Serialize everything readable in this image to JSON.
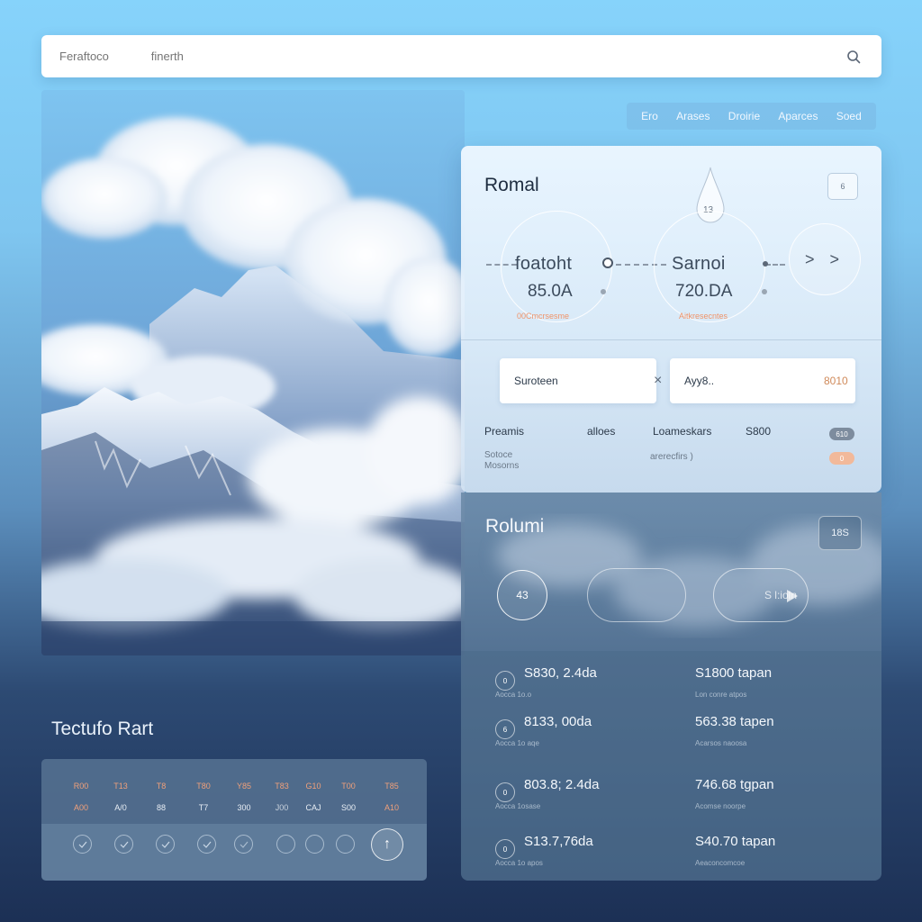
{
  "search": {
    "placeholder": "Feraftoco   finerth"
  },
  "top_nav": {
    "items": [
      "Ero",
      "Arases",
      "Droirie",
      "Aparces",
      "Soed"
    ]
  },
  "hero": {
    "image": "mountain-clouds"
  },
  "card_top": {
    "title": "Romal",
    "corner_badge": "6",
    "drop_label": "13",
    "gauge_left": {
      "label": "foatoht",
      "value": "85.0A",
      "sub": "00Cmcrsesme"
    },
    "gauge_right": {
      "label": "Sarnoi",
      "value": "720.DA",
      "sub": "Aitkresecntes"
    },
    "next_glyph": "> >",
    "field_left": {
      "value": "Suroteen",
      "clear_glyph": "×"
    },
    "field_right": {
      "value": "Ayy8..",
      "amount": "8010"
    },
    "meta": {
      "col1": "Preamis",
      "col2": "alloes",
      "col3": "Loameskars",
      "col4": "S800",
      "sub1_line1": "Sotoce",
      "sub1_line2": "Mosorns",
      "sub2": "arerecfirs )",
      "pill1": "610",
      "pill2": "0"
    },
    "accent_color": "#f0946a"
  },
  "card_bottom": {
    "title": "Rolumi",
    "badge": "18S",
    "circle_value": "43",
    "play_label": "S l:ioln",
    "rows": [
      {
        "icon": "0",
        "main": "S830, 2.4da",
        "main_sub": "Aocca 1o.o",
        "right": "S1800 tapan",
        "right_sub": "Lon conre atpos"
      },
      {
        "icon": "6",
        "main": "8133, 00da",
        "main_sub": "Aocca 1o aqe",
        "right": "563.38 tapen",
        "right_sub": "Acarsos naoosa"
      },
      {
        "icon": "0",
        "main": "803.8; 2.4da",
        "main_sub": "Aocca 1osase",
        "right": "746.68 tgpan",
        "right_sub": "Acomse noorpe"
      },
      {
        "icon": "0",
        "main": "S13.7,76da",
        "main_sub": "Aocca 1o apos",
        "right": "S40.70 tapan",
        "right_sub": "Aeaconcomcoe"
      }
    ]
  },
  "bottom_left": {
    "title": "Tectufo Rart",
    "headers": [
      "R00",
      "T13",
      "T8",
      "T80",
      "Y85",
      "T83",
      "G10",
      "T00",
      "T85"
    ],
    "values": [
      "A00",
      "A/0",
      "88",
      "T7",
      "300",
      "J00",
      "CAJ",
      "S00",
      "A10"
    ],
    "checks": [
      "check",
      "check",
      "check",
      "check",
      "check",
      "check",
      "check",
      "check"
    ],
    "upload_glyph": "↑"
  }
}
